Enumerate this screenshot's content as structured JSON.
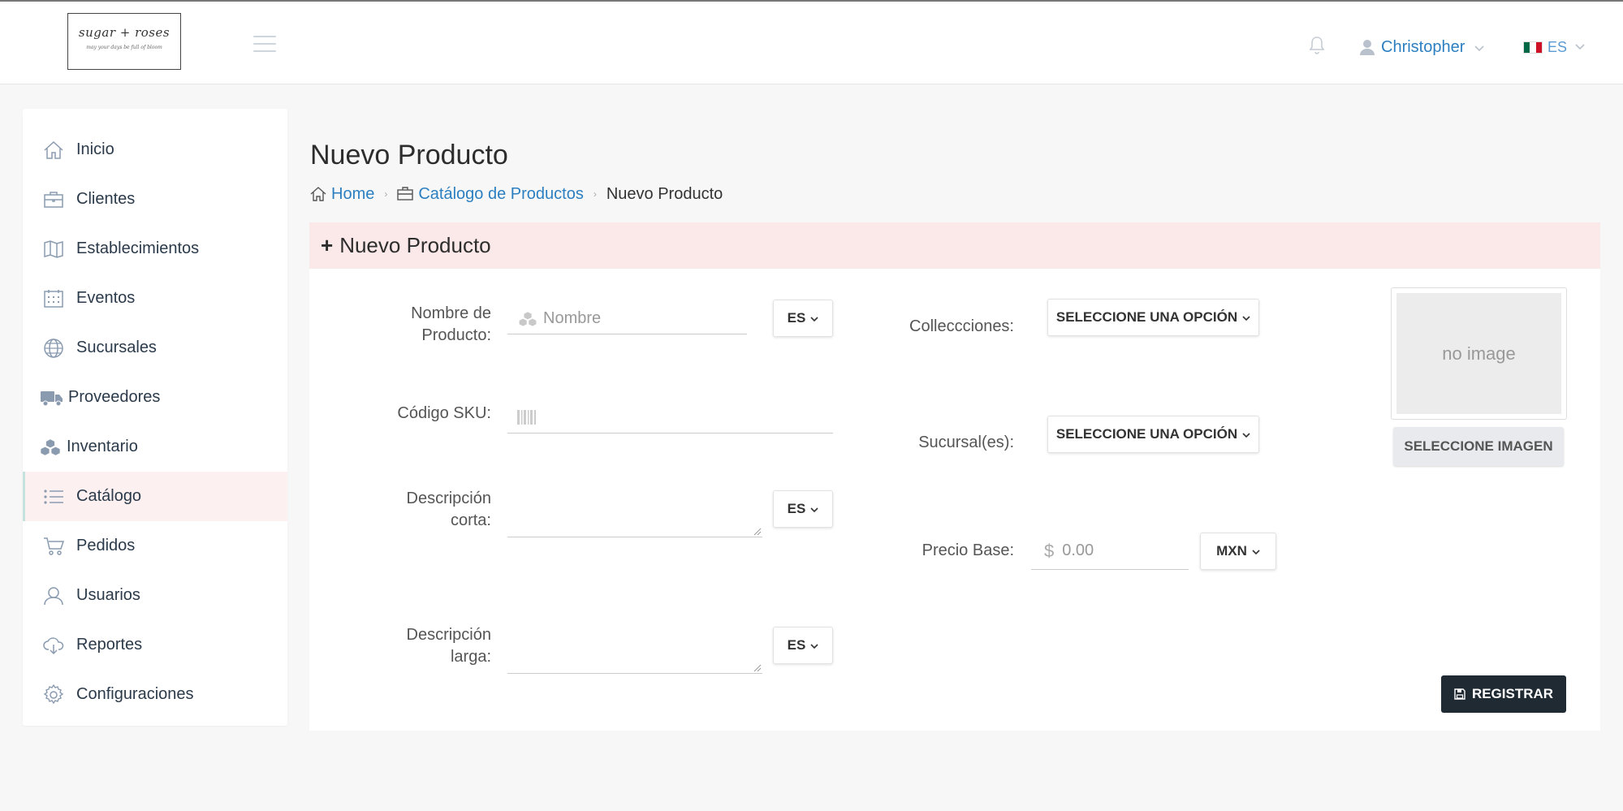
{
  "header": {
    "logo_line1": "sugar + roses",
    "logo_line2": "may your days be full of bloom",
    "user_name": "Christopher",
    "lang_code": "ES",
    "flag_colors": [
      "#006847",
      "#ffffff",
      "#ce1126"
    ]
  },
  "sidebar": {
    "items": [
      {
        "label": "Inicio",
        "icon": "home-icon"
      },
      {
        "label": "Clientes",
        "icon": "briefcase-icon"
      },
      {
        "label": "Establecimientos",
        "icon": "map-icon"
      },
      {
        "label": "Eventos",
        "icon": "calendar-icon"
      },
      {
        "label": "Sucursales",
        "icon": "globe-icon"
      },
      {
        "label": "Proveedores",
        "icon": "truck-icon"
      },
      {
        "label": "Inventario",
        "icon": "cubes-icon"
      },
      {
        "label": "Catálogo",
        "icon": "list-icon",
        "active": true
      },
      {
        "label": "Pedidos",
        "icon": "cart-icon"
      },
      {
        "label": "Usuarios",
        "icon": "user-icon"
      },
      {
        "label": "Reportes",
        "icon": "cloud-download-icon"
      },
      {
        "label": "Configuraciones",
        "icon": "gear-icon"
      }
    ]
  },
  "page": {
    "title": "Nuevo Producto",
    "breadcrumb": {
      "home": "Home",
      "catalog": "Catálogo de Productos",
      "current": "Nuevo Producto"
    }
  },
  "panel": {
    "heading_plus": "+",
    "heading": "Nuevo Producto"
  },
  "form": {
    "nombre_label": "Nombre de Producto:",
    "nombre_placeholder": "Nombre",
    "nombre_lang": "ES",
    "sku_label": "Código SKU:",
    "sku_value": "",
    "desc_corta_label": "Descripción corta:",
    "desc_corta_lang": "ES",
    "desc_larga_label": "Descripción larga:",
    "desc_larga_lang": "ES",
    "colecciones_label": "Colleccciones:",
    "colecciones_value": "SELECCIONE UNA OPCIÓN",
    "sucursales_label": "Sucursal(es):",
    "sucursales_value": "SELECCIONE UNA OPCIÓN",
    "precio_label": "Precio Base:",
    "precio_currency_symbol": "$",
    "precio_placeholder": "0.00",
    "precio_currency": "MXN",
    "image_placeholder": "no image",
    "select_image_button": "SELECCIONE IMAGEN",
    "submit_button": "REGISTRAR"
  },
  "colors": {
    "link": "#2c7fc0",
    "panel_header_bg": "#fbe8e8",
    "active_nav_bg": "#fdf0f0",
    "submit_bg": "#1f2a33"
  }
}
